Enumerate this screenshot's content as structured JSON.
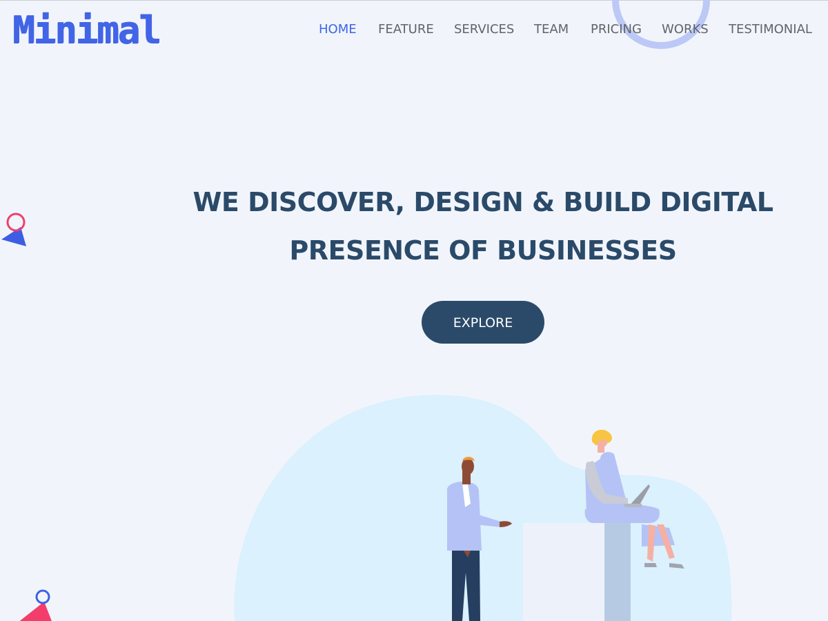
{
  "header": {
    "logo_text": "Minimal",
    "nav": [
      {
        "label": "HOME",
        "active": true
      },
      {
        "label": "FEATURE",
        "active": false
      },
      {
        "label": "SERVICES",
        "active": false
      },
      {
        "label": "TEAM",
        "active": false
      },
      {
        "label": "PRICING",
        "active": false
      },
      {
        "label": "WORKS",
        "active": false
      },
      {
        "label": "TESTIMONIAL",
        "active": false
      }
    ]
  },
  "hero": {
    "title_line1": "WE DISCOVER, DESIGN & BUILD DIGITAL",
    "title_line2": "PRESENCE OF BUSINESSES",
    "cta_label": "EXPLORE"
  },
  "colors": {
    "accent": "#3e64e8",
    "heading": "#2b4a69",
    "background": "#f1f5fb",
    "blob": "#dbf1fd",
    "pink": "#f43a6a"
  }
}
